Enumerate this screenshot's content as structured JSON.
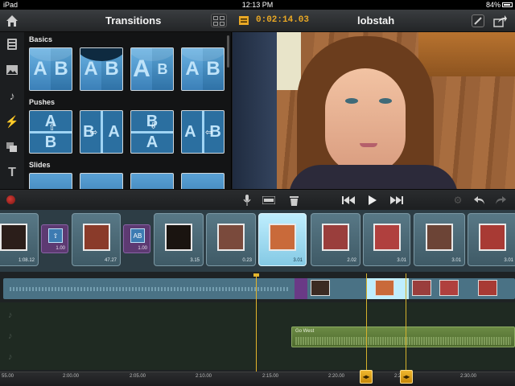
{
  "status_bar": {
    "device": "iPad",
    "time": "12:13 PM",
    "battery": "84%",
    "battery_level": 0.84
  },
  "header": {
    "left_title": "Transitions",
    "timecode": "0:02:14.03",
    "project_title": "lobstah",
    "icons": [
      "home-icon",
      "layout-grid-icon",
      "film-icon",
      "settings-icon",
      "share-icon"
    ]
  },
  "tools": [
    "clips-icon",
    "photos-icon",
    "music-icon",
    "transitions-icon",
    "overlay-icon",
    "title-icon"
  ],
  "transitions_panel": {
    "sections": [
      {
        "label": "Basics",
        "tiles": [
          {
            "name": "crossfade",
            "left": "A",
            "right": "B"
          },
          {
            "name": "dip-to-black",
            "left": "A",
            "right": "B"
          },
          {
            "name": "zoom",
            "left": "A",
            "right": "B"
          },
          {
            "name": "wipe",
            "left": "A",
            "right": "B"
          }
        ]
      },
      {
        "label": "Pushes",
        "tiles": [
          {
            "name": "push-up",
            "left": "A",
            "right": "B"
          },
          {
            "name": "push-left",
            "left": "B",
            "right": "A"
          },
          {
            "name": "push-down",
            "left": "B",
            "right": "A"
          },
          {
            "name": "push-right",
            "left": "A",
            "right": "B"
          }
        ]
      },
      {
        "label": "Slides",
        "tiles": []
      }
    ]
  },
  "transport": {
    "icons": [
      "record-icon",
      "microphone-icon",
      "trim-icon",
      "trash-icon",
      "skip-back-icon",
      "play-icon",
      "skip-forward-icon",
      "settings-cogs-icon",
      "undo-icon",
      "redo-icon"
    ]
  },
  "clips": [
    {
      "type": "clip",
      "duration": "1:08.12",
      "selected": false
    },
    {
      "type": "transition",
      "duration": "1.00"
    },
    {
      "type": "clip",
      "duration": "47.27",
      "selected": false
    },
    {
      "type": "transition",
      "duration": "1.00"
    },
    {
      "type": "clip",
      "duration": "3.15",
      "selected": false
    },
    {
      "type": "clip",
      "duration": "0.23",
      "selected": false
    },
    {
      "type": "clip",
      "duration": "3.01",
      "selected": true
    },
    {
      "type": "clip",
      "duration": "2.02",
      "selected": false
    },
    {
      "type": "clip",
      "duration": "3.01",
      "selected": false
    },
    {
      "type": "clip",
      "duration": "3.01",
      "selected": false
    },
    {
      "type": "clip",
      "duration": "3.01",
      "selected": false
    }
  ],
  "timeline": {
    "music_clip_label": "Go West",
    "ruler_ticks": [
      "55.00",
      "2:00.00",
      "2:05.00",
      "2:10.00",
      "2:15.00",
      "2:20.00",
      "2:25.00",
      "2:30.00"
    ],
    "handle_glyph": "◂▸"
  },
  "colors": {
    "accent": "#e9a825",
    "selected_clip": "#bfeefe",
    "transition": "#6a3a86",
    "music": "#6b8a44",
    "record": "#d23b35"
  }
}
